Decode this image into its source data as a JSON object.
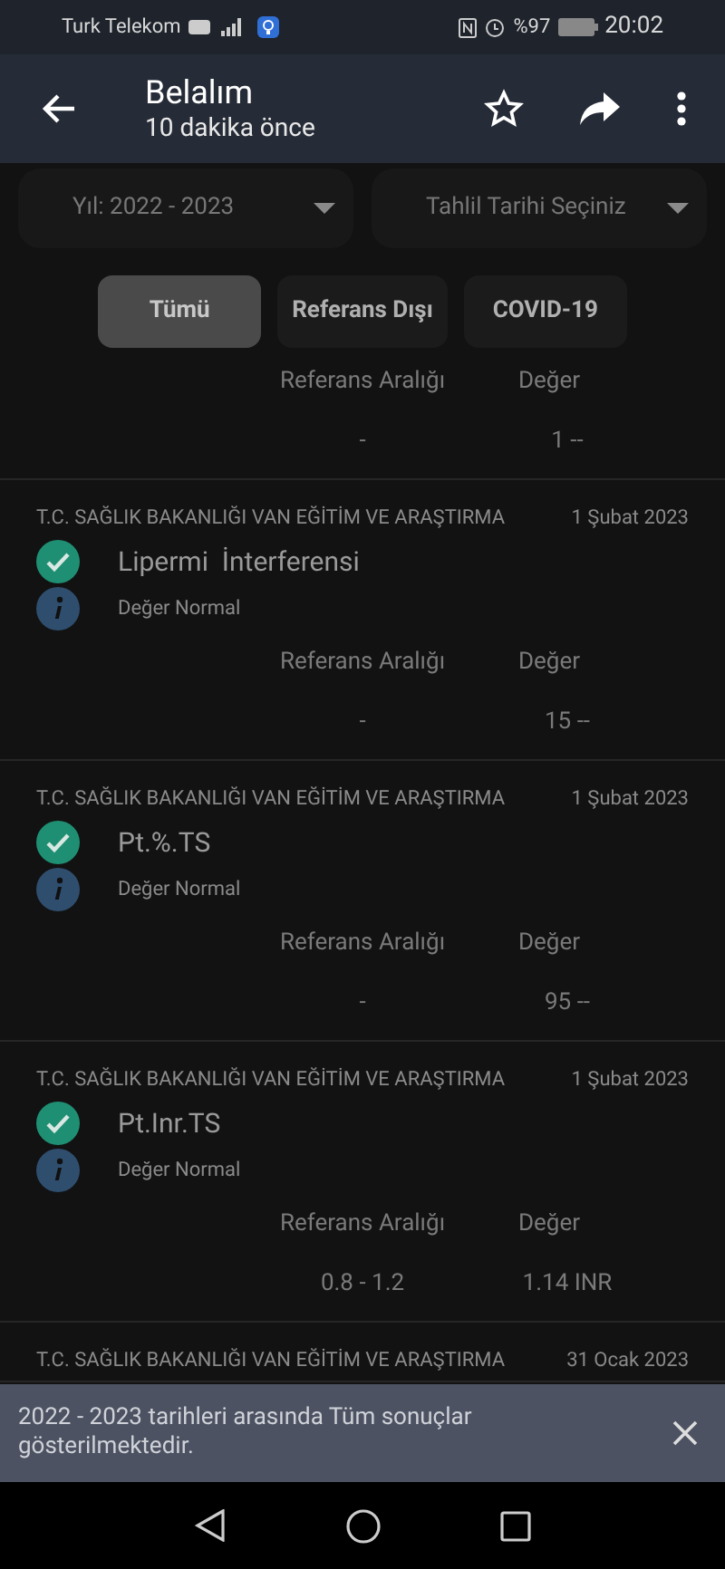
{
  "status_bar": {
    "carrier": "Turk Telekom",
    "battery": "%97",
    "time": "20:02"
  },
  "header": {
    "title": "Belalım",
    "subtitle": "10 dakika önce"
  },
  "dropdowns": [
    {
      "label": "Yıl: 2022 - 2023"
    },
    {
      "label": "Tahlil Tarihi Seçiniz"
    }
  ],
  "filter_tabs": [
    {
      "label": "Tümü",
      "selected": true
    },
    {
      "label": "Referans Dışı",
      "selected": false
    },
    {
      "label": "COVID-19",
      "selected": false
    }
  ],
  "results": [
    {
      "range_label": "Referans Aralığı",
      "value_label": "Değer",
      "range": "-",
      "value": "1 --"
    },
    {
      "institution": "T.C. SAĞLIK BAKANLIĞI VAN EĞİTİM VE ARAŞTIRMA",
      "date": "1 Şubat 2023",
      "name": "Lipermi  İnterferensi",
      "status": "Değer Normal",
      "range_label": "Referans Aralığı",
      "value_label": "Değer",
      "range": "-",
      "value": "15 --"
    },
    {
      "institution": "T.C. SAĞLIK BAKANLIĞI VAN EĞİTİM VE ARAŞTIRMA",
      "date": "1 Şubat 2023",
      "name": "Pt.%.TS",
      "status": "Değer Normal",
      "range_label": "Referans Aralığı",
      "value_label": "Değer",
      "range": "-",
      "value": "95 --"
    },
    {
      "institution": "T.C. SAĞLIK BAKANLIĞI VAN EĞİTİM VE ARAŞTIRMA",
      "date": "1 Şubat 2023",
      "name": "Pt.Inr.TS",
      "status": "Değer Normal",
      "range_label": "Referans Aralığı",
      "value_label": "Değer",
      "range": "0.8 - 1.2",
      "value": "1.14 INR"
    },
    {
      "institution": "T.C. SAĞLIK BAKANLIĞI VAN EĞİTİM VE ARAŞTIRMA",
      "date": "31 Ocak 2023"
    }
  ],
  "snackbar": {
    "message": "2022 - 2023 tarihleri arasında Tüm sonuçlar gösterilmektedir."
  }
}
